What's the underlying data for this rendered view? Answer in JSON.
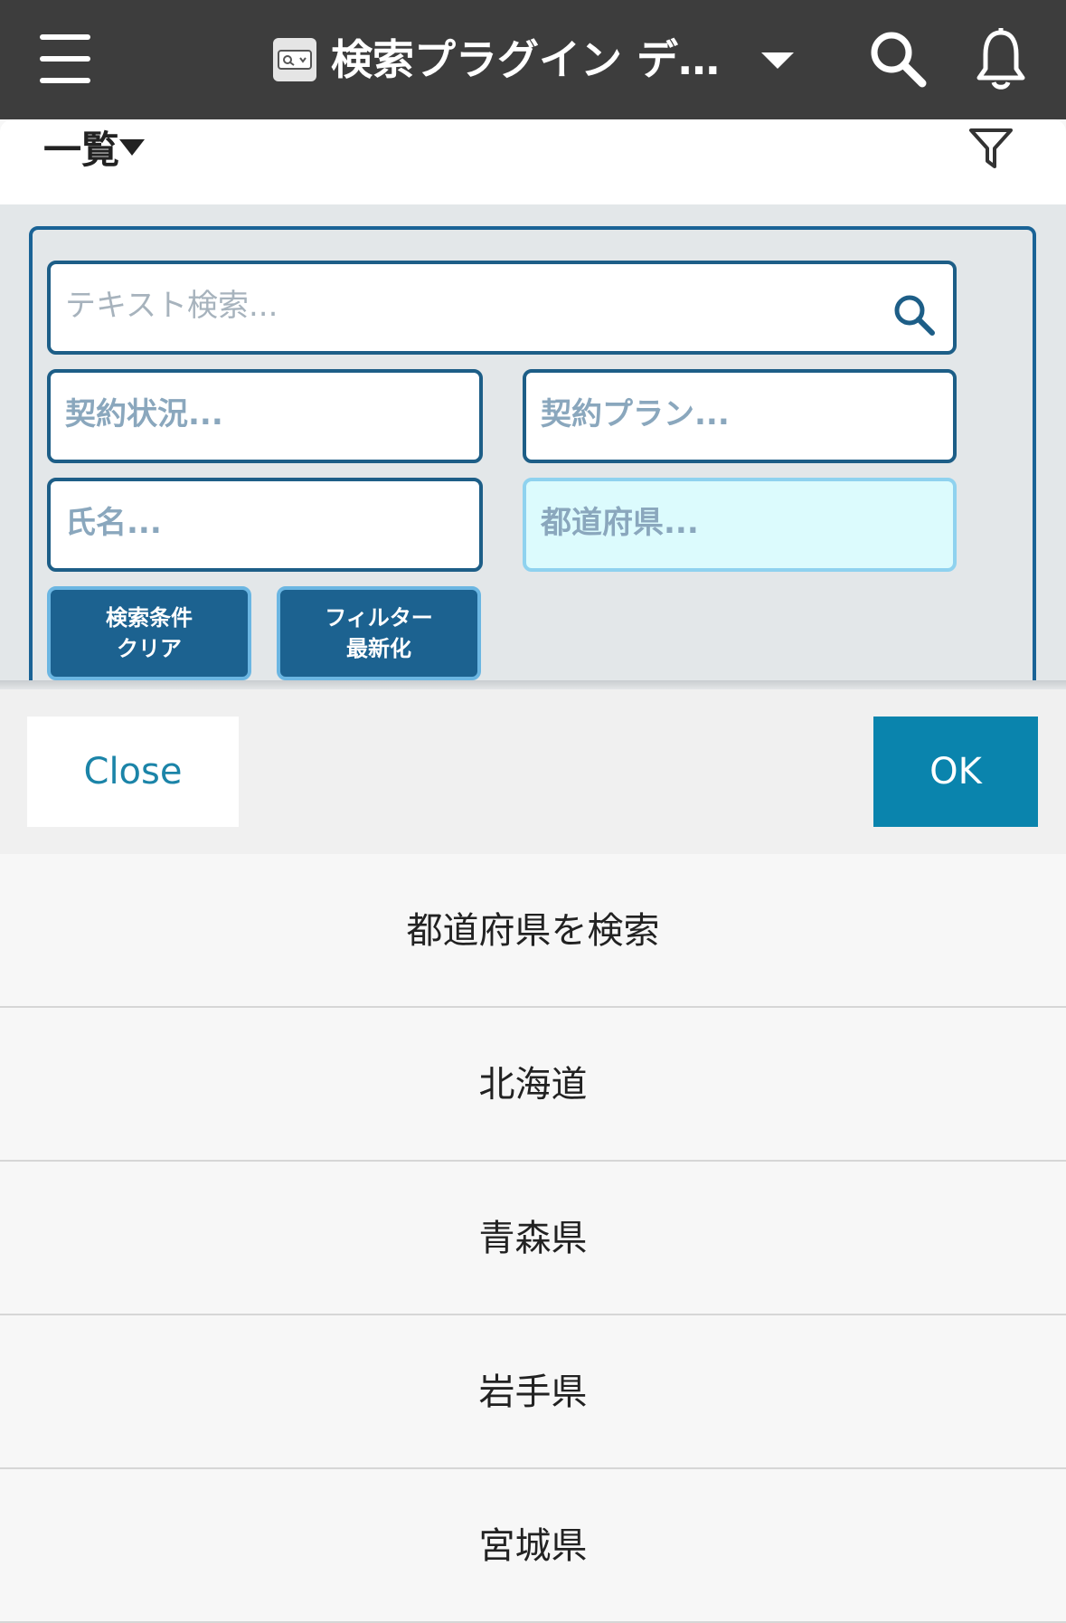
{
  "topbar": {
    "title": "検索プラグイン デ…"
  },
  "list_header": {
    "view_label": "一覧"
  },
  "filters": {
    "text_search_placeholder": "テキスト検索...",
    "contract_status_placeholder": "契約状況...",
    "contract_plan_placeholder": "契約プラン...",
    "name_placeholder": "氏名...",
    "prefecture_placeholder": "都道府県...",
    "clear_button": [
      "検索条件",
      "クリア"
    ],
    "refresh_button": [
      "フィルター",
      "最新化"
    ]
  },
  "picker": {
    "close_label": "Close",
    "ok_label": "OK",
    "options": [
      "都道府県を検索",
      "北海道",
      "青森県",
      "岩手県",
      "宮城県"
    ]
  },
  "colors": {
    "topbar": "#3d3d3d",
    "field_border": "#1d5e87",
    "button_bg": "#1c6290",
    "ok_button": "#0a84ad",
    "close_text": "#1b84a8"
  }
}
